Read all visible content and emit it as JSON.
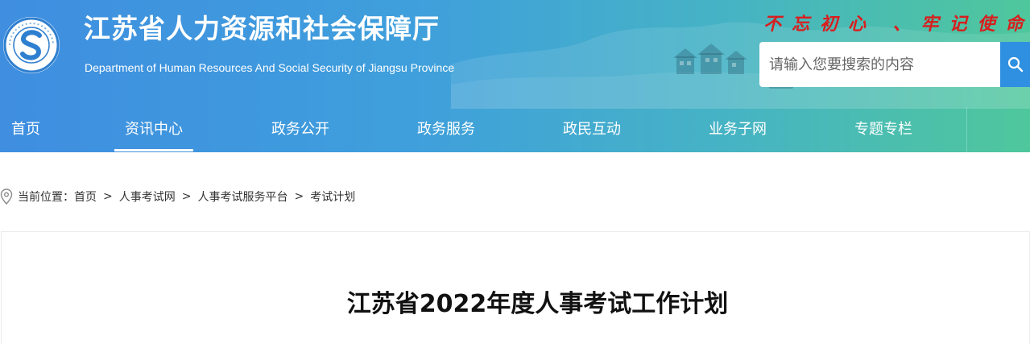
{
  "header": {
    "logo_icon": "department-seal-logo-icon",
    "title": "江苏省人力资源和社会保障厅",
    "subtitle": "Department of Human Resources And Social Security of Jiangsu Province",
    "slogan": "不忘初心 、牢记使命",
    "search": {
      "placeholder": "请输入您要搜索的内容",
      "button_icon": "search-icon"
    },
    "colors": {
      "gradient_start": "#3f8ee0",
      "gradient_end": "#4fc79c",
      "slogan": "#d81e1e",
      "search_button": "#2f8fe0"
    }
  },
  "nav": {
    "items": [
      {
        "label": "首页"
      },
      {
        "label": "资讯中心",
        "active": true
      },
      {
        "label": "政务公开"
      },
      {
        "label": "政务服务"
      },
      {
        "label": "政民互动"
      },
      {
        "label": "业务子网"
      },
      {
        "label": "专题专栏"
      }
    ]
  },
  "breadcrumb": {
    "icon": "location-pin-icon",
    "prefix": "当前位置：",
    "items": [
      "首页",
      "人事考试网",
      "人事考试服务平台",
      "考试计划"
    ],
    "separator": ">"
  },
  "article": {
    "title": "江苏省2022年度人事考试工作计划"
  }
}
